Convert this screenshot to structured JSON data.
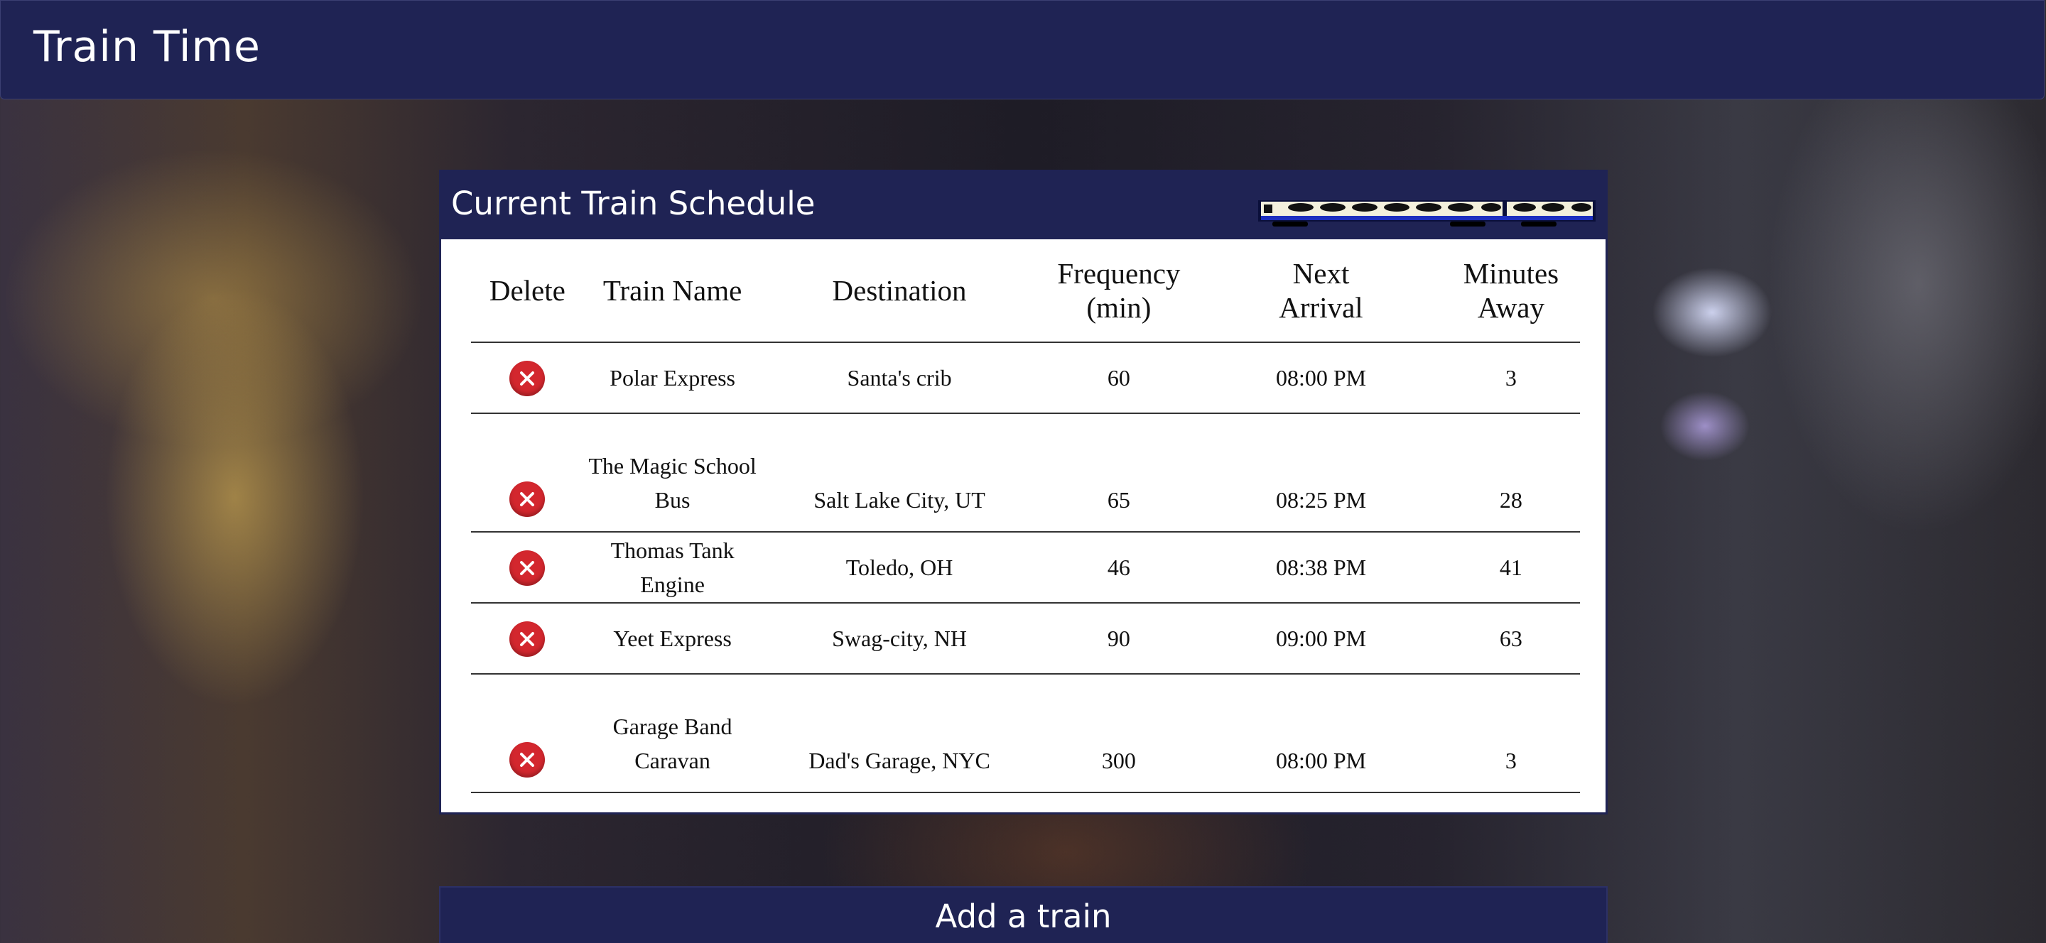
{
  "navbar": {
    "brand": "Train Time"
  },
  "schedule": {
    "title": "Current Train Schedule",
    "headers": {
      "delete": "Delete",
      "train_name": "Train Name",
      "destination": "Destination",
      "frequency_line1": "Frequency",
      "frequency_line2": "(min)",
      "next_arrival_line1": "Next",
      "next_arrival_line2": "Arrival",
      "minutes_away_line1": "Minutes",
      "minutes_away_line2": "Away"
    },
    "rows": [
      {
        "name": "Polar Express",
        "destination": "Santa's crib",
        "frequency": "60",
        "next_arrival": "08:00 PM",
        "minutes_away": "3"
      },
      {
        "name": "The Magic School Bus",
        "destination": "Salt Lake City, UT",
        "frequency": "65",
        "next_arrival": "08:25 PM",
        "minutes_away": "28"
      },
      {
        "name": "Thomas Tank Engine",
        "destination": "Toledo, OH",
        "frequency": "46",
        "next_arrival": "08:38 PM",
        "minutes_away": "41"
      },
      {
        "name": "Yeet Express",
        "destination": "Swag-city, NH",
        "frequency": "90",
        "next_arrival": "09:00 PM",
        "minutes_away": "63"
      },
      {
        "name": "Garage Band Caravan",
        "destination": "Dad's Garage, NYC",
        "frequency": "300",
        "next_arrival": "08:00 PM",
        "minutes_away": "3"
      }
    ]
  },
  "add_train": {
    "title": "Add a train"
  },
  "icons": {
    "delete": "close-circle-icon",
    "train": "train-icon"
  },
  "colors": {
    "nav_bg": "#1f2354",
    "delete_red": "#d3272e",
    "panel_bg": "#ffffff"
  }
}
